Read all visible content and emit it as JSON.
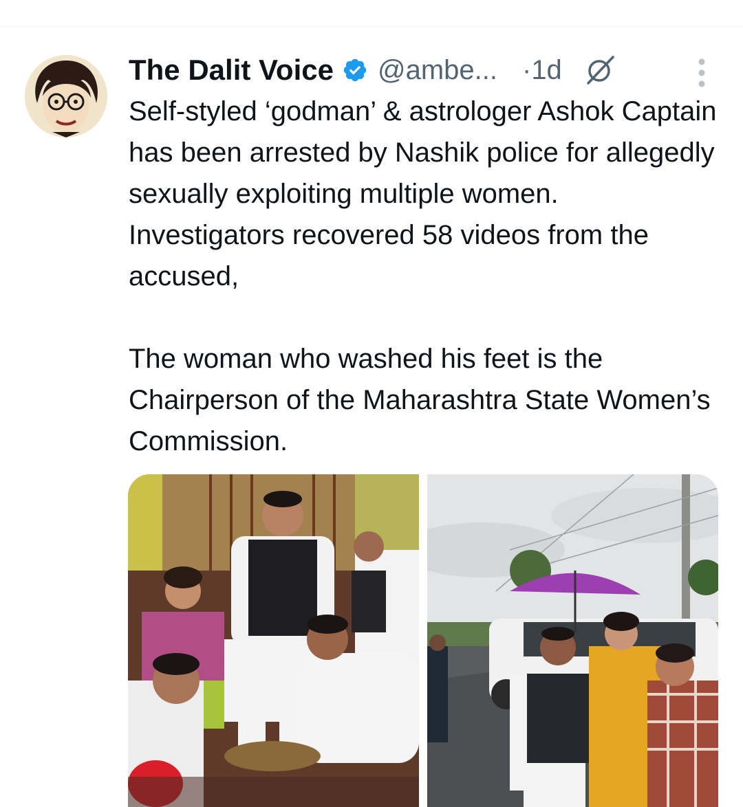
{
  "tweet": {
    "author": {
      "display_name": "The Dalit Voice",
      "handle": "@ambe...",
      "verified": true,
      "avatar": "portrait-sketch-avatar"
    },
    "dot": "·",
    "timestamp": "1d",
    "text": "Self-styled ‘godman’ & astrologer Ashok Captain has been arrested by Nashik police for allegedly sexually exploiting multiple women. Investigators recovered 58 videos from the accused,\n\nThe woman who washed his feet is the Chairperson of the Maharashtra State Women’s Commission.",
    "icons": {
      "verified": "verified-badge-icon",
      "grok": "grok-icon",
      "more": "more-options-icon"
    },
    "colors": {
      "verified": "#1d9bf0",
      "secondary_text": "#536471",
      "primary_text": "#0f1419"
    },
    "media_count": 2
  }
}
